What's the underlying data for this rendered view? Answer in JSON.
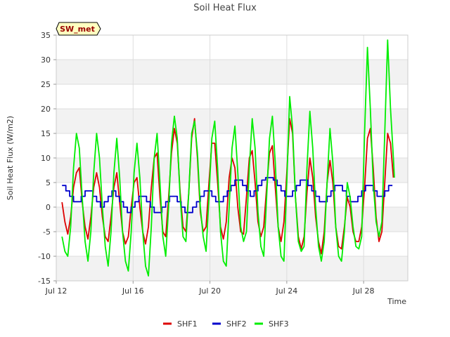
{
  "chart_data": {
    "type": "line",
    "title": "Soil Heat Flux",
    "xlabel": "Time",
    "ylabel": "Soil Heat Flux (W/m2)",
    "site_badge": "SW_met",
    "x_unit": "days (2022-07-12 = 12)",
    "xlim": [
      12,
      30.3
    ],
    "ylim": [
      -15,
      35
    ],
    "x_ticks": [
      {
        "value": 12,
        "label": "Jul 12"
      },
      {
        "value": 16,
        "label": "Jul 16"
      },
      {
        "value": 20,
        "label": "Jul 20"
      },
      {
        "value": 24,
        "label": "Jul 24"
      },
      {
        "value": 28,
        "label": "Jul 28"
      }
    ],
    "y_ticks": [
      -15,
      -10,
      -5,
      0,
      5,
      10,
      15,
      20,
      25,
      30,
      35
    ],
    "grid": true,
    "legend_position": "bottom",
    "series": [
      {
        "name": "SHF1",
        "color": "#dd0000",
        "points": [
          [
            12.3,
            1
          ],
          [
            12.45,
            -3
          ],
          [
            12.6,
            -5.5
          ],
          [
            12.75,
            -2
          ],
          [
            12.9,
            4
          ],
          [
            13.05,
            7
          ],
          [
            13.2,
            8
          ],
          [
            13.35,
            1
          ],
          [
            13.5,
            -4
          ],
          [
            13.65,
            -6.5
          ],
          [
            13.8,
            -2
          ],
          [
            13.95,
            4
          ],
          [
            14.1,
            7
          ],
          [
            14.25,
            4
          ],
          [
            14.4,
            -2
          ],
          [
            14.55,
            -6
          ],
          [
            14.7,
            -7
          ],
          [
            14.85,
            -2
          ],
          [
            15.0,
            4
          ],
          [
            15.15,
            7
          ],
          [
            15.3,
            1
          ],
          [
            15.45,
            -5
          ],
          [
            15.6,
            -7.5
          ],
          [
            15.75,
            -6
          ],
          [
            15.9,
            0
          ],
          [
            16.05,
            5
          ],
          [
            16.2,
            6
          ],
          [
            16.35,
            0
          ],
          [
            16.5,
            -5
          ],
          [
            16.65,
            -7.5
          ],
          [
            16.8,
            -4
          ],
          [
            16.95,
            4
          ],
          [
            17.1,
            10
          ],
          [
            17.25,
            11
          ],
          [
            17.4,
            2
          ],
          [
            17.55,
            -5
          ],
          [
            17.7,
            -6
          ],
          [
            17.85,
            2
          ],
          [
            18.0,
            11
          ],
          [
            18.15,
            16
          ],
          [
            18.3,
            13
          ],
          [
            18.45,
            3
          ],
          [
            18.6,
            -4
          ],
          [
            18.75,
            -5
          ],
          [
            18.9,
            3
          ],
          [
            19.05,
            14
          ],
          [
            19.2,
            18
          ],
          [
            19.35,
            10
          ],
          [
            19.5,
            -1
          ],
          [
            19.65,
            -5
          ],
          [
            19.8,
            -4
          ],
          [
            19.95,
            5
          ],
          [
            20.1,
            13
          ],
          [
            20.25,
            13
          ],
          [
            20.4,
            5
          ],
          [
            20.55,
            -4
          ],
          [
            20.7,
            -6.5
          ],
          [
            20.85,
            -3
          ],
          [
            21.0,
            6
          ],
          [
            21.15,
            10
          ],
          [
            21.3,
            8
          ],
          [
            21.45,
            0
          ],
          [
            21.6,
            -5
          ],
          [
            21.75,
            -5.5
          ],
          [
            21.9,
            2
          ],
          [
            22.05,
            10
          ],
          [
            22.2,
            11.5
          ],
          [
            22.35,
            5
          ],
          [
            22.5,
            -3
          ],
          [
            22.65,
            -6
          ],
          [
            22.8,
            -4
          ],
          [
            22.95,
            4
          ],
          [
            23.1,
            11
          ],
          [
            23.25,
            12.5
          ],
          [
            23.4,
            4
          ],
          [
            23.55,
            -4
          ],
          [
            23.7,
            -7
          ],
          [
            23.85,
            -3
          ],
          [
            24.0,
            7
          ],
          [
            24.15,
            18
          ],
          [
            24.3,
            15
          ],
          [
            24.45,
            2
          ],
          [
            24.6,
            -6
          ],
          [
            24.75,
            -8.5
          ],
          [
            24.9,
            -6
          ],
          [
            25.05,
            3
          ],
          [
            25.2,
            10
          ],
          [
            25.35,
            6
          ],
          [
            25.5,
            -2
          ],
          [
            25.65,
            -7
          ],
          [
            25.8,
            -9.5
          ],
          [
            25.95,
            -5
          ],
          [
            26.1,
            5
          ],
          [
            26.25,
            9.5
          ],
          [
            26.4,
            5
          ],
          [
            26.55,
            -4
          ],
          [
            26.7,
            -8
          ],
          [
            26.85,
            -8.5
          ],
          [
            27.0,
            -4
          ],
          [
            27.15,
            2
          ],
          [
            27.3,
            0
          ],
          [
            27.45,
            -5
          ],
          [
            27.6,
            -7
          ],
          [
            27.75,
            -7
          ],
          [
            27.9,
            -4
          ],
          [
            28.05,
            4
          ],
          [
            28.2,
            14
          ],
          [
            28.35,
            16
          ],
          [
            28.5,
            8
          ],
          [
            28.65,
            -2
          ],
          [
            28.8,
            -7
          ],
          [
            28.95,
            -5
          ],
          [
            29.1,
            5
          ],
          [
            29.25,
            15
          ],
          [
            29.4,
            13
          ],
          [
            29.55,
            6
          ]
        ]
      },
      {
        "name": "SHF2",
        "color": "#0000cc",
        "points": [
          [
            12.3,
            4.4
          ],
          [
            12.5,
            3.3
          ],
          [
            12.7,
            2.2
          ],
          [
            12.9,
            1.1
          ],
          [
            13.1,
            1.1
          ],
          [
            13.3,
            2.2
          ],
          [
            13.5,
            3.3
          ],
          [
            13.7,
            3.3
          ],
          [
            13.9,
            2.2
          ],
          [
            14.1,
            1.1
          ],
          [
            14.3,
            0
          ],
          [
            14.5,
            1.1
          ],
          [
            14.7,
            2.2
          ],
          [
            14.9,
            3.3
          ],
          [
            15.1,
            2.2
          ],
          [
            15.3,
            1.1
          ],
          [
            15.5,
            0
          ],
          [
            15.7,
            -1.1
          ],
          [
            15.9,
            0
          ],
          [
            16.1,
            1.1
          ],
          [
            16.3,
            2.2
          ],
          [
            16.5,
            2.2
          ],
          [
            16.7,
            1.1
          ],
          [
            16.9,
            0
          ],
          [
            17.1,
            -1.1
          ],
          [
            17.3,
            -1.1
          ],
          [
            17.5,
            0
          ],
          [
            17.7,
            1.1
          ],
          [
            17.9,
            2.2
          ],
          [
            18.1,
            2.2
          ],
          [
            18.3,
            1.1
          ],
          [
            18.5,
            0
          ],
          [
            18.7,
            -1.1
          ],
          [
            18.9,
            -1.1
          ],
          [
            19.1,
            0
          ],
          [
            19.3,
            1.1
          ],
          [
            19.5,
            2.2
          ],
          [
            19.7,
            3.3
          ],
          [
            19.9,
            3.3
          ],
          [
            20.1,
            2.2
          ],
          [
            20.3,
            1.1
          ],
          [
            20.5,
            1.1
          ],
          [
            20.7,
            2.2
          ],
          [
            20.9,
            3.3
          ],
          [
            21.1,
            4.4
          ],
          [
            21.3,
            5.5
          ],
          [
            21.5,
            5.5
          ],
          [
            21.7,
            4.4
          ],
          [
            21.9,
            3.3
          ],
          [
            22.1,
            2.2
          ],
          [
            22.3,
            3.3
          ],
          [
            22.5,
            4.4
          ],
          [
            22.7,
            5.5
          ],
          [
            22.9,
            6
          ],
          [
            23.1,
            6
          ],
          [
            23.3,
            5.5
          ],
          [
            23.5,
            4.4
          ],
          [
            23.7,
            3.3
          ],
          [
            23.9,
            2.2
          ],
          [
            24.1,
            2.2
          ],
          [
            24.3,
            3.3
          ],
          [
            24.5,
            4.4
          ],
          [
            24.7,
            5.5
          ],
          [
            24.9,
            5.5
          ],
          [
            25.1,
            4.4
          ],
          [
            25.3,
            3.3
          ],
          [
            25.5,
            2.2
          ],
          [
            25.7,
            1.1
          ],
          [
            25.9,
            1.1
          ],
          [
            26.1,
            2.2
          ],
          [
            26.3,
            3.3
          ],
          [
            26.5,
            4.4
          ],
          [
            26.7,
            4.4
          ],
          [
            26.9,
            3.3
          ],
          [
            27.1,
            2.2
          ],
          [
            27.3,
            1.1
          ],
          [
            27.5,
            1.1
          ],
          [
            27.7,
            2.2
          ],
          [
            27.9,
            3.3
          ],
          [
            28.1,
            4.4
          ],
          [
            28.3,
            4.4
          ],
          [
            28.5,
            3.3
          ],
          [
            28.7,
            2.2
          ],
          [
            28.9,
            2.2
          ],
          [
            29.1,
            3.3
          ],
          [
            29.3,
            4.4
          ],
          [
            29.5,
            4.4
          ]
        ]
      },
      {
        "name": "SHF3",
        "color": "#00ee00",
        "points": [
          [
            12.3,
            -6
          ],
          [
            12.45,
            -9
          ],
          [
            12.6,
            -10
          ],
          [
            12.75,
            -4
          ],
          [
            12.9,
            8
          ],
          [
            13.05,
            15
          ],
          [
            13.2,
            12
          ],
          [
            13.35,
            2
          ],
          [
            13.5,
            -7
          ],
          [
            13.65,
            -11
          ],
          [
            13.8,
            -5
          ],
          [
            13.95,
            7
          ],
          [
            14.1,
            15
          ],
          [
            14.25,
            10
          ],
          [
            14.4,
            0
          ],
          [
            14.55,
            -8
          ],
          [
            14.7,
            -12
          ],
          [
            14.85,
            -5
          ],
          [
            15.0,
            7
          ],
          [
            15.15,
            14
          ],
          [
            15.3,
            6
          ],
          [
            15.45,
            -5
          ],
          [
            15.6,
            -11
          ],
          [
            15.75,
            -13
          ],
          [
            15.9,
            -5
          ],
          [
            16.05,
            7
          ],
          [
            16.2,
            13
          ],
          [
            16.35,
            6
          ],
          [
            16.5,
            -5
          ],
          [
            16.65,
            -12
          ],
          [
            16.8,
            -14
          ],
          [
            16.95,
            -4
          ],
          [
            17.1,
            10
          ],
          [
            17.25,
            15
          ],
          [
            17.4,
            5
          ],
          [
            17.55,
            -6
          ],
          [
            17.7,
            -10
          ],
          [
            17.85,
            0
          ],
          [
            18.0,
            13
          ],
          [
            18.15,
            18.5
          ],
          [
            18.3,
            14
          ],
          [
            18.45,
            2
          ],
          [
            18.6,
            -6
          ],
          [
            18.75,
            -7
          ],
          [
            18.9,
            3
          ],
          [
            19.05,
            15
          ],
          [
            19.2,
            17.5
          ],
          [
            19.35,
            11
          ],
          [
            19.5,
            0
          ],
          [
            19.65,
            -6
          ],
          [
            19.8,
            -9
          ],
          [
            19.95,
            2
          ],
          [
            20.1,
            14
          ],
          [
            20.25,
            17.5
          ],
          [
            20.4,
            8
          ],
          [
            20.55,
            -5
          ],
          [
            20.7,
            -11
          ],
          [
            20.85,
            -12
          ],
          [
            21.0,
            0
          ],
          [
            21.15,
            12
          ],
          [
            21.3,
            16.5
          ],
          [
            21.45,
            7
          ],
          [
            21.6,
            -4
          ],
          [
            21.75,
            -7
          ],
          [
            21.9,
            -5
          ],
          [
            22.05,
            8
          ],
          [
            22.2,
            18
          ],
          [
            22.35,
            12
          ],
          [
            22.5,
            -1
          ],
          [
            22.65,
            -8
          ],
          [
            22.8,
            -10
          ],
          [
            22.95,
            2
          ],
          [
            23.1,
            14
          ],
          [
            23.25,
            18.5
          ],
          [
            23.4,
            9
          ],
          [
            23.55,
            -4
          ],
          [
            23.7,
            -10
          ],
          [
            23.85,
            -11
          ],
          [
            24.0,
            5
          ],
          [
            24.15,
            22.5
          ],
          [
            24.3,
            16
          ],
          [
            24.45,
            2
          ],
          [
            24.6,
            -7
          ],
          [
            24.75,
            -9
          ],
          [
            24.9,
            -8
          ],
          [
            25.05,
            8
          ],
          [
            25.2,
            19.5
          ],
          [
            25.35,
            12
          ],
          [
            25.5,
            0
          ],
          [
            25.65,
            -8
          ],
          [
            25.8,
            -11
          ],
          [
            25.95,
            -7
          ],
          [
            26.1,
            5
          ],
          [
            26.25,
            16
          ],
          [
            26.4,
            9
          ],
          [
            26.55,
            -4
          ],
          [
            26.7,
            -10
          ],
          [
            26.85,
            -11
          ],
          [
            27.0,
            -5
          ],
          [
            27.15,
            5
          ],
          [
            27.3,
            2
          ],
          [
            27.45,
            -4
          ],
          [
            27.6,
            -8
          ],
          [
            27.75,
            -8.5
          ],
          [
            27.9,
            -6
          ],
          [
            28.05,
            15
          ],
          [
            28.2,
            32.5
          ],
          [
            28.35,
            20
          ],
          [
            28.5,
            5
          ],
          [
            28.65,
            -3
          ],
          [
            28.8,
            -6
          ],
          [
            28.95,
            -3
          ],
          [
            29.1,
            15
          ],
          [
            29.25,
            34
          ],
          [
            29.4,
            20
          ],
          [
            29.55,
            10
          ],
          [
            29.6,
            6
          ]
        ]
      }
    ]
  }
}
